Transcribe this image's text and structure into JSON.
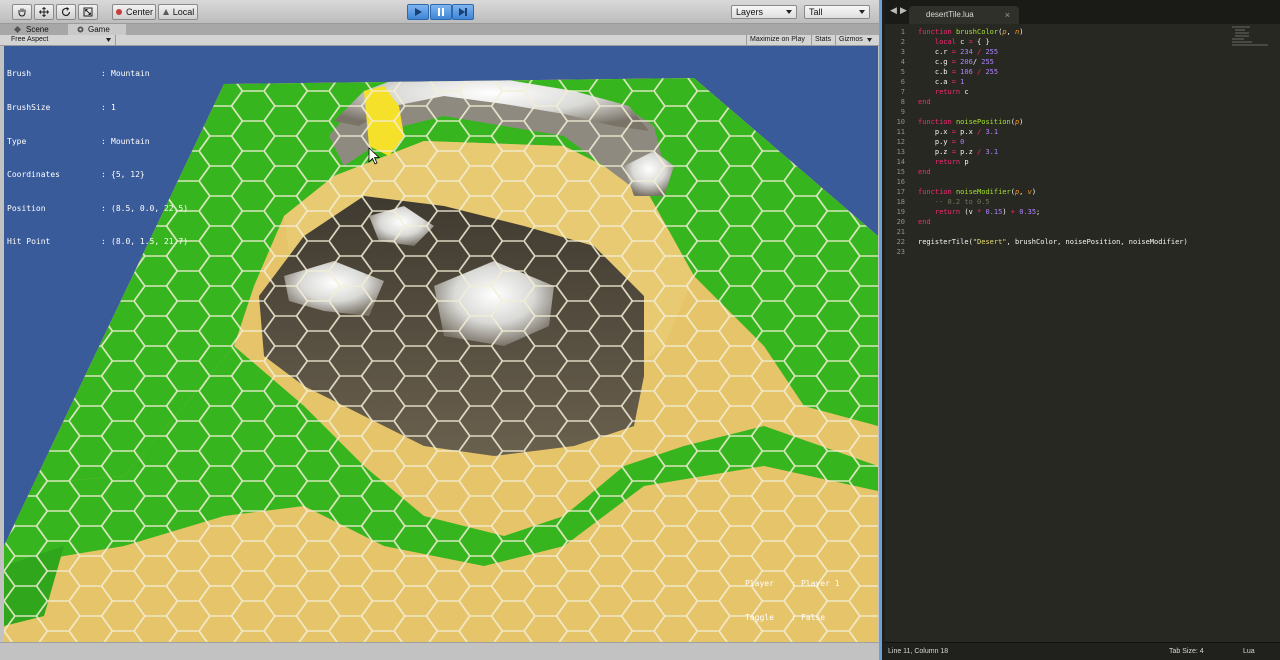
{
  "unity": {
    "toolbar": {
      "tools": [
        {
          "icon": "hand-icon"
        },
        {
          "icon": "move-icon"
        },
        {
          "icon": "rotate-icon"
        },
        {
          "icon": "scale-icon"
        }
      ],
      "center_label": "Center",
      "local_label": "Local",
      "layers_label": "Layers",
      "layout_label": "Tall"
    },
    "tabs": [
      {
        "label": "Scene",
        "icon": "scene-icon"
      },
      {
        "label": "Game",
        "icon": "game-icon"
      }
    ],
    "game_bar": {
      "aspect_label": "Free Aspect",
      "maximize_label": "Maximize on Play",
      "stats_label": "Stats",
      "gizmos_label": "Gizmos"
    },
    "info": [
      {
        "key": "Brush",
        "value": "Mountain"
      },
      {
        "key": "BrushSize",
        "value": "1"
      },
      {
        "key": "Type",
        "value": "Mountain"
      },
      {
        "key": "Coordinates",
        "value": "{5, 12}"
      },
      {
        "key": "Position",
        "value": "(8.5, 0.0, 22.5)"
      },
      {
        "key": "Hit Point",
        "value": "(8.0, 1.5, 21.7)"
      }
    ],
    "player_info": [
      {
        "key": "Player",
        "value": "Player 1"
      },
      {
        "key": "Toggle",
        "value": "False"
      }
    ],
    "colors": {
      "sky": "#3a5b99",
      "grass": "#36b51f",
      "sand": "#e6c46a",
      "rock": "#5b5343",
      "snow": "#efefef",
      "highlight": "#f5e02a"
    }
  },
  "editor": {
    "tab_title": "desertTile.lua",
    "code_lines": [
      [
        {
          "t": "function ",
          "c": "kw"
        },
        {
          "t": "brushColor",
          "c": "fn"
        },
        {
          "t": "("
        },
        {
          "t": "p",
          "c": "arg"
        },
        {
          "t": ", "
        },
        {
          "t": "n",
          "c": "arg"
        },
        {
          "t": ")"
        }
      ],
      [
        {
          "t": "    "
        },
        {
          "t": "local",
          "c": "kw"
        },
        {
          "t": " c "
        },
        {
          "t": "=",
          "c": "kw"
        },
        {
          "t": " { }"
        }
      ],
      [
        {
          "t": "    c.r "
        },
        {
          "t": "=",
          "c": "kw"
        },
        {
          "t": " "
        },
        {
          "t": "234",
          "c": "num"
        },
        {
          "t": " "
        },
        {
          "t": "/",
          "c": "kw"
        },
        {
          "t": " "
        },
        {
          "t": "255",
          "c": "num"
        }
      ],
      [
        {
          "t": "    c.g "
        },
        {
          "t": "=",
          "c": "kw"
        },
        {
          "t": " "
        },
        {
          "t": "206",
          "c": "num"
        },
        {
          "t": "/ "
        },
        {
          "t": "255",
          "c": "num"
        }
      ],
      [
        {
          "t": "    c.b "
        },
        {
          "t": "=",
          "c": "kw"
        },
        {
          "t": " "
        },
        {
          "t": "106",
          "c": "num"
        },
        {
          "t": " "
        },
        {
          "t": "/",
          "c": "kw"
        },
        {
          "t": " "
        },
        {
          "t": "255",
          "c": "num"
        }
      ],
      [
        {
          "t": "    c.a "
        },
        {
          "t": "=",
          "c": "kw"
        },
        {
          "t": " "
        },
        {
          "t": "1",
          "c": "num"
        }
      ],
      [
        {
          "t": "    "
        },
        {
          "t": "return",
          "c": "kw"
        },
        {
          "t": " c"
        }
      ],
      [
        {
          "t": "end",
          "c": "kw"
        }
      ],
      [],
      [
        {
          "t": "function ",
          "c": "kw"
        },
        {
          "t": "noisePosition",
          "c": "fn"
        },
        {
          "t": "("
        },
        {
          "t": "p",
          "c": "arg"
        },
        {
          "t": ")"
        }
      ],
      [
        {
          "t": "    p.x "
        },
        {
          "t": "=",
          "c": "kw"
        },
        {
          "t": " p.x "
        },
        {
          "t": "/",
          "c": "kw"
        },
        {
          "t": " "
        },
        {
          "t": "3.1",
          "c": "num"
        }
      ],
      [
        {
          "t": "    p.y "
        },
        {
          "t": "=",
          "c": "kw"
        },
        {
          "t": " "
        },
        {
          "t": "0",
          "c": "num"
        }
      ],
      [
        {
          "t": "    p.z "
        },
        {
          "t": "=",
          "c": "kw"
        },
        {
          "t": " p.z "
        },
        {
          "t": "/",
          "c": "kw"
        },
        {
          "t": " "
        },
        {
          "t": "3.1",
          "c": "num"
        }
      ],
      [
        {
          "t": "    "
        },
        {
          "t": "return",
          "c": "kw"
        },
        {
          "t": " p"
        }
      ],
      [
        {
          "t": "end",
          "c": "kw"
        }
      ],
      [],
      [
        {
          "t": "function ",
          "c": "kw"
        },
        {
          "t": "noiseModifier",
          "c": "fn"
        },
        {
          "t": "("
        },
        {
          "t": "p",
          "c": "arg"
        },
        {
          "t": ", "
        },
        {
          "t": "v",
          "c": "arg"
        },
        {
          "t": ")"
        }
      ],
      [
        {
          "t": "    -- 0.2 to 0.5",
          "c": "cm"
        }
      ],
      [
        {
          "t": "    "
        },
        {
          "t": "return",
          "c": "kw"
        },
        {
          "t": " (v "
        },
        {
          "t": "*",
          "c": "kw"
        },
        {
          "t": " "
        },
        {
          "t": "0.15",
          "c": "num"
        },
        {
          "t": ") "
        },
        {
          "t": "+",
          "c": "kw"
        },
        {
          "t": " "
        },
        {
          "t": "0.35",
          "c": "num"
        },
        {
          "t": ";"
        }
      ],
      [
        {
          "t": "end",
          "c": "kw"
        }
      ],
      [],
      [
        {
          "t": "registerTile("
        },
        {
          "t": "\"Desert\"",
          "c": "str"
        },
        {
          "t": ", brushColor, noisePosition, noiseModifier)"
        }
      ],
      []
    ],
    "status": {
      "position": "Line 11, Column 18",
      "tab_size": "Tab Size: 4",
      "syntax": "Lua"
    }
  }
}
